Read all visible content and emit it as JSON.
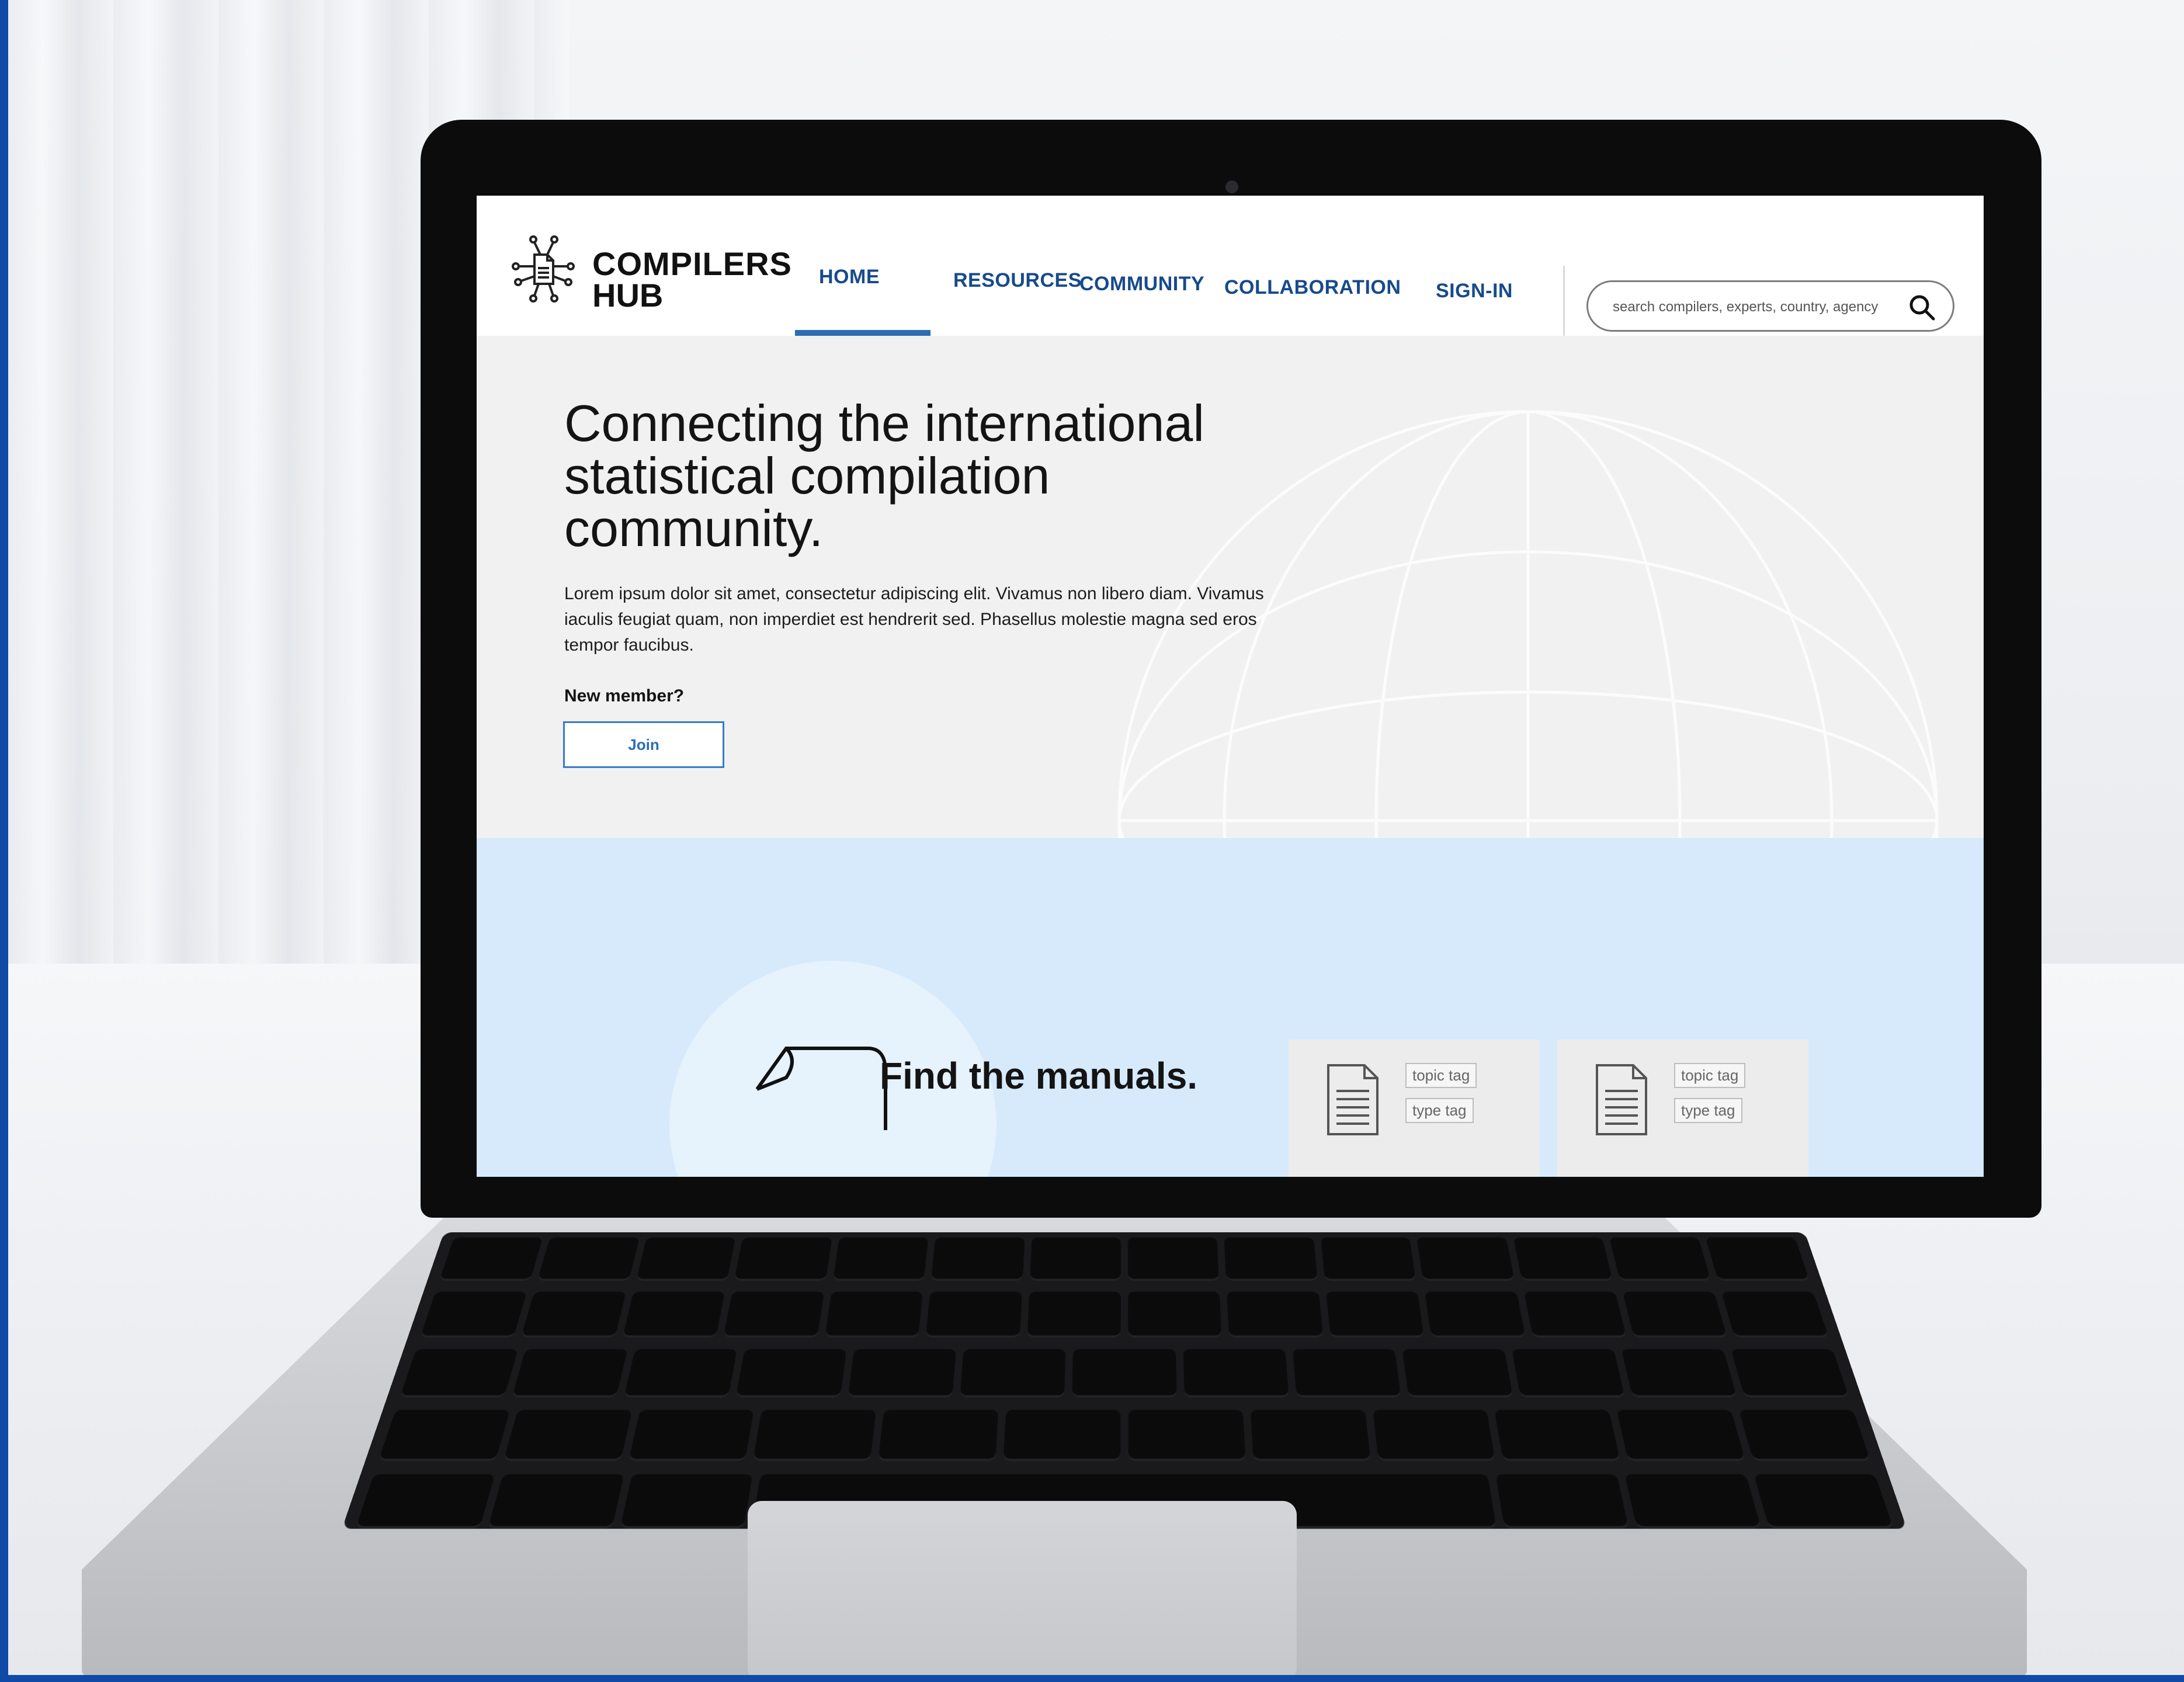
{
  "site": {
    "brand_line1": "COMPILERS",
    "brand_line2": "HUB",
    "logo_icon": "document-network-icon"
  },
  "nav": {
    "items": [
      {
        "label": "HOME",
        "active": true
      },
      {
        "label": "RESOURCES",
        "active": false
      },
      {
        "label": "COMMUNITY",
        "active": false
      },
      {
        "label": "COLLABORATION",
        "active": false
      },
      {
        "label": "SIGN-IN",
        "active": false
      }
    ],
    "accent_color": "#2b6cb5"
  },
  "search": {
    "placeholder": "search compilers, experts, country, agency",
    "icon": "search-icon"
  },
  "hero": {
    "title": "Connecting the international statistical compilation community.",
    "body": "Lorem ipsum dolor sit amet, consectetur adipiscing elit. Vivamus non libero diam. Vivamus iaculis feugiat quam, non imperdiet est hendrerit sed. Phasellus molestie magna sed eros tempor faucibus.",
    "new_member_label": "New member?",
    "join_label": "Join"
  },
  "manuals": {
    "title": "Find the manuals."
  },
  "cards": [
    {
      "topic_tag": "topic tag",
      "type_tag": "type tag",
      "icon": "document-icon"
    },
    {
      "topic_tag": "topic tag",
      "type_tag": "type tag",
      "icon": "document-icon"
    }
  ],
  "colors": {
    "band_background": "#d6eafb",
    "nav_text": "#174a8c",
    "frame_border": "#0f4aa6"
  }
}
